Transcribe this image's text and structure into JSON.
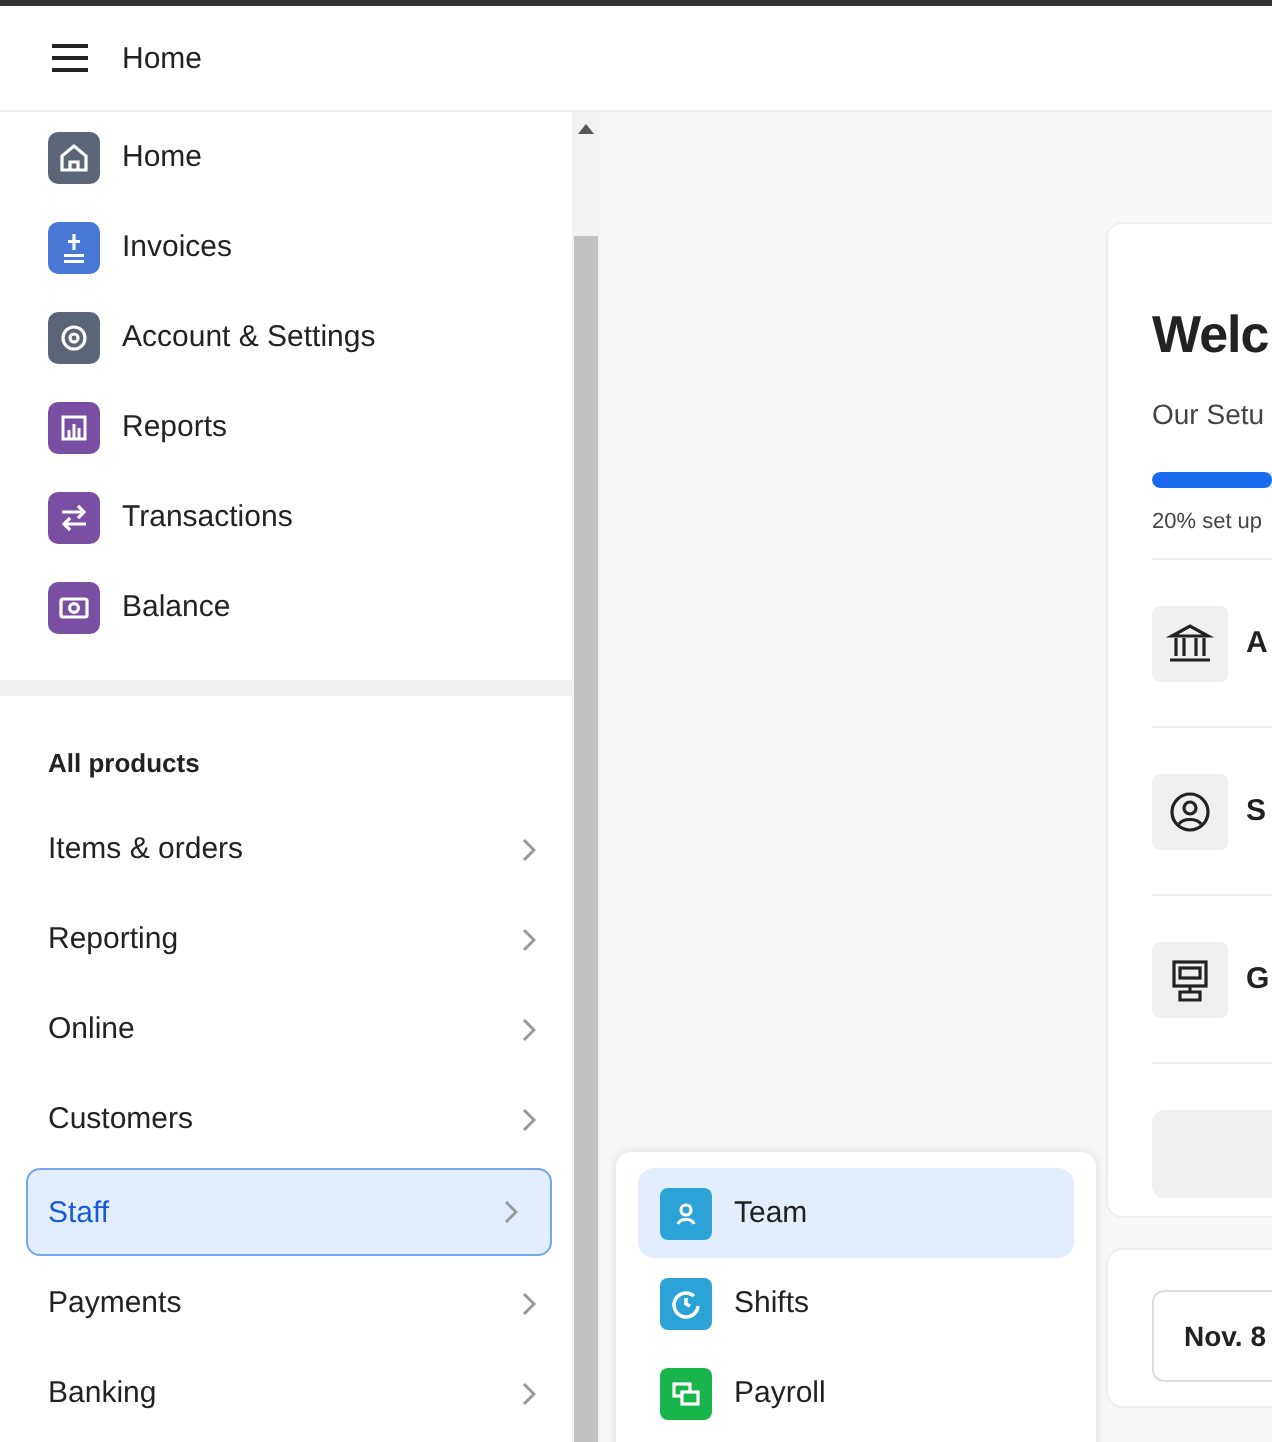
{
  "header": {
    "title": "Home"
  },
  "sidebar": {
    "items": [
      {
        "label": "Home",
        "color": "#5b6577"
      },
      {
        "label": "Invoices",
        "color": "#4a78d6"
      },
      {
        "label": "Account & Settings",
        "color": "#5b6577"
      },
      {
        "label": "Reports",
        "color": "#7a4fa3"
      },
      {
        "label": "Transactions",
        "color": "#7a4fa3"
      },
      {
        "label": "Balance",
        "color": "#7a4fa3"
      }
    ],
    "products": {
      "heading": "All products",
      "items": [
        {
          "label": "Items & orders",
          "selected": false
        },
        {
          "label": "Reporting",
          "selected": false
        },
        {
          "label": "Online",
          "selected": false
        },
        {
          "label": "Customers",
          "selected": false
        },
        {
          "label": "Staff",
          "selected": true
        },
        {
          "label": "Payments",
          "selected": false
        },
        {
          "label": "Banking",
          "selected": false
        }
      ]
    }
  },
  "submenu": {
    "items": [
      {
        "label": "Team",
        "color": "#2ba3d6",
        "selected": true
      },
      {
        "label": "Shifts",
        "color": "#2ba3d6",
        "selected": false
      },
      {
        "label": "Payroll",
        "color": "#18b54a",
        "selected": false
      }
    ]
  },
  "welcome_card": {
    "title": "Welc",
    "subtitle": "Our Setu",
    "progress": {
      "level": 0.2,
      "caption": "20% set up"
    },
    "tasks": [
      {
        "label": "A"
      },
      {
        "label": "S"
      },
      {
        "label": "G"
      }
    ]
  },
  "date_button": {
    "label": "Nov. 8"
  }
}
